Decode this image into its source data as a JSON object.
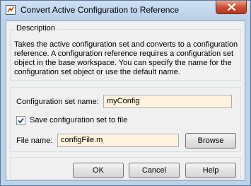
{
  "window": {
    "title": "Convert Active Configuration to Reference"
  },
  "description": {
    "legend": "Description",
    "text": "Takes the active configuration set and converts to a configuration reference. A configuration reference requires a configuration set object in the base workspace. You can specify the name for the configuration set object or use the default name."
  },
  "form": {
    "config_name_label": "Configuration set name:",
    "config_name_value": "myConfig",
    "save_checkbox_label": "Save configuration set to file",
    "save_checkbox_checked": true,
    "file_name_label": "File name:",
    "file_name_value": "configFile.m",
    "browse_label": "Browse"
  },
  "buttons": {
    "ok_label": "OK",
    "cancel_label": "Cancel",
    "help_label": "Help"
  },
  "colors": {
    "field_background": "#fdf3de",
    "close_button": "#c84b31",
    "titlebar": "#bcd3ec"
  }
}
